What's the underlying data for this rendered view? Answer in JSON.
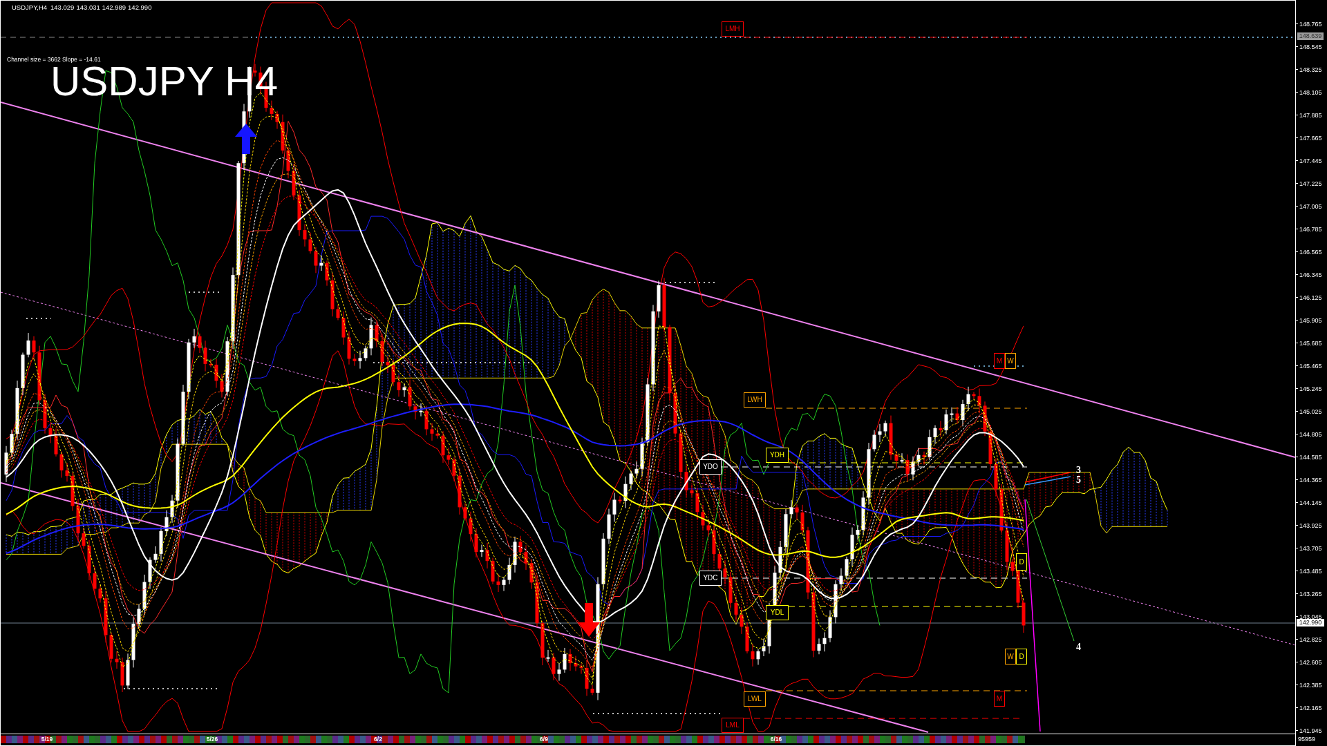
{
  "chart_header": {
    "symbol": "USDJPY,H4",
    "ohlc": [
      "143.029",
      "143.031",
      "142.989",
      "142.990"
    ]
  },
  "channel_info": "Channel size = 3662 Slope = -14.61",
  "chart_title": "USDJPY H4",
  "level_labels": [
    {
      "text": "LMH",
      "color": "#ff0000"
    },
    {
      "text": "M",
      "color": "#ff0000"
    },
    {
      "text": "W",
      "color": "#ffa500"
    },
    {
      "text": "LWH",
      "color": "#ffa500"
    },
    {
      "text": "YDH",
      "color": "#ffff00"
    },
    {
      "text": "YDO",
      "color": "#ffffff"
    },
    {
      "text": "D",
      "color": "#ffff00"
    },
    {
      "text": "YDC",
      "color": "#ffffff"
    },
    {
      "text": "YDL",
      "color": "#ffff00"
    },
    {
      "text": "W",
      "color": "#ffa500"
    },
    {
      "text": "D",
      "color": "#ffff00"
    },
    {
      "text": "LWL",
      "color": "#ffa500"
    },
    {
      "text": "M",
      "color": "#ff0000"
    },
    {
      "text": "LML",
      "color": "#ff0000"
    }
  ],
  "wave_labels": [
    "3",
    "5",
    "4"
  ],
  "price_axis": {
    "ticks": [
      "148.765",
      "148.545",
      "148.325",
      "148.105",
      "147.885",
      "147.665",
      "147.445",
      "147.225",
      "147.005",
      "146.785",
      "146.565",
      "146.345",
      "146.125",
      "145.905",
      "145.685",
      "145.465",
      "145.245",
      "145.025",
      "144.805",
      "144.585",
      "144.365",
      "144.145",
      "143.925",
      "143.705",
      "143.485",
      "143.265",
      "143.045",
      "142.825",
      "142.605",
      "142.385",
      "142.165",
      "141.945"
    ],
    "marker": "148.639",
    "current_price": "142.990"
  },
  "time_axis": {
    "dates": [
      "5/19",
      "5/26",
      "6/2",
      "6/9",
      "6/16"
    ],
    "bar_count": "95959"
  }
}
